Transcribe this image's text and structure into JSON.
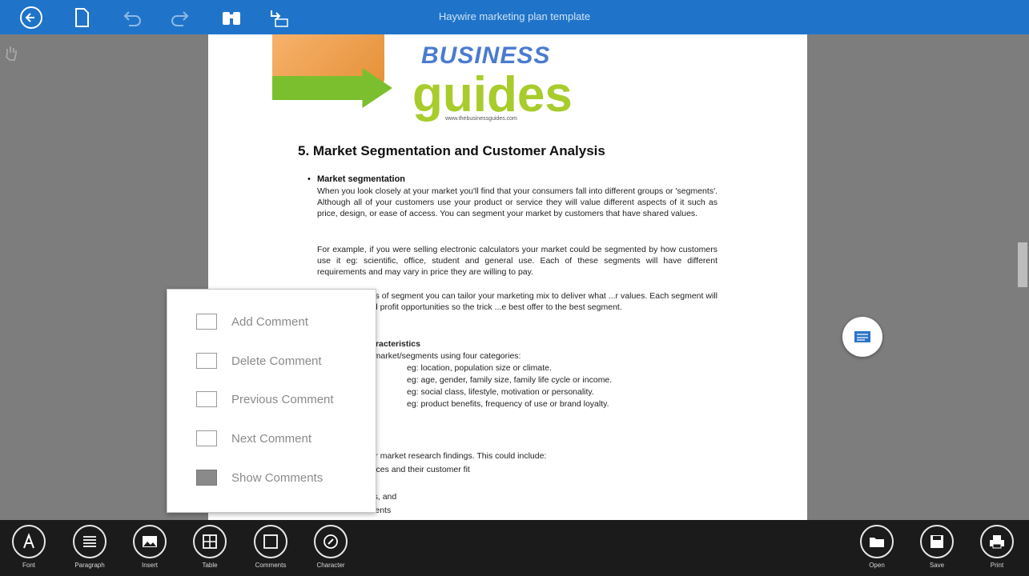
{
  "window": {
    "title": "Haywire marketing plan template"
  },
  "toolbar": {
    "icons": [
      "back-icon",
      "document-icon",
      "undo-icon",
      "redo-icon",
      "find-icon",
      "goto-page-icon"
    ]
  },
  "document": {
    "logo_business": "BUSINESS",
    "logo_guides": "guides",
    "logo_tagline": "www.thebusinessguides.com",
    "heading": "5. Market Segmentation and Customer Analysis",
    "bullet_title": "Market segmentation",
    "p1": "When you look closely at your market you'll find that your consumers fall into different groups or 'segments'. Although all of your customers use your product or service they will value different aspects of it such as price, design, or ease of access. You can segment your market by customers that have shared values.",
    "p2": "For example, if you were selling electronic calculators your market could be segmented by how customers use it eg: scientific, office, student and general use. Each of these segments will have different requirements and may vary in price they are willing to pay.",
    "p3": "...ding the needs of segment you can tailor your marketing mix to deliver what ...r values. Each segment will offer growth and profit opportunities so the trick ...e best offer to the best segment.",
    "p4": "...segment characteristics",
    "p5a": "...e your target market/segments using four categories:",
    "p5b": "eg: location, population size or climate.",
    "p5c": "eg: age, gender, family size, family life cycle or income.",
    "p5d": "eg: social class, lifestyle, motivation or personality.",
    "p5e": "eg: product benefits, frequency of use or brand loyalty.",
    "p6a": "...rch findings",
    "p6b": "...mmary of your market research findings. This could include:",
    "p6c": "...ucts and services and their customer fit",
    "p6d": "...profiles",
    "p6e": "...characteristics, and",
    "p6f": "...trends and events"
  },
  "context_menu": {
    "items": [
      {
        "label": "Add Comment",
        "icon": "add-comment-icon"
      },
      {
        "label": "Delete Comment",
        "icon": "delete-comment-icon"
      },
      {
        "label": "Previous Comment",
        "icon": "previous-comment-icon"
      },
      {
        "label": "Next Comment",
        "icon": "next-comment-icon"
      },
      {
        "label": "Show Comments",
        "icon": "show-comments-icon"
      }
    ]
  },
  "appbar": {
    "left": [
      {
        "label": "Font",
        "icon": "font-icon"
      },
      {
        "label": "Paragraph",
        "icon": "paragraph-icon"
      },
      {
        "label": "Insert",
        "icon": "insert-image-icon"
      },
      {
        "label": "Table",
        "icon": "table-icon"
      },
      {
        "label": "Comments",
        "icon": "comments-icon"
      },
      {
        "label": "Character",
        "icon": "character-icon"
      }
    ],
    "right": [
      {
        "label": "Open",
        "icon": "open-folder-icon"
      },
      {
        "label": "Save",
        "icon": "save-icon"
      },
      {
        "label": "Print",
        "icon": "print-icon"
      }
    ]
  }
}
